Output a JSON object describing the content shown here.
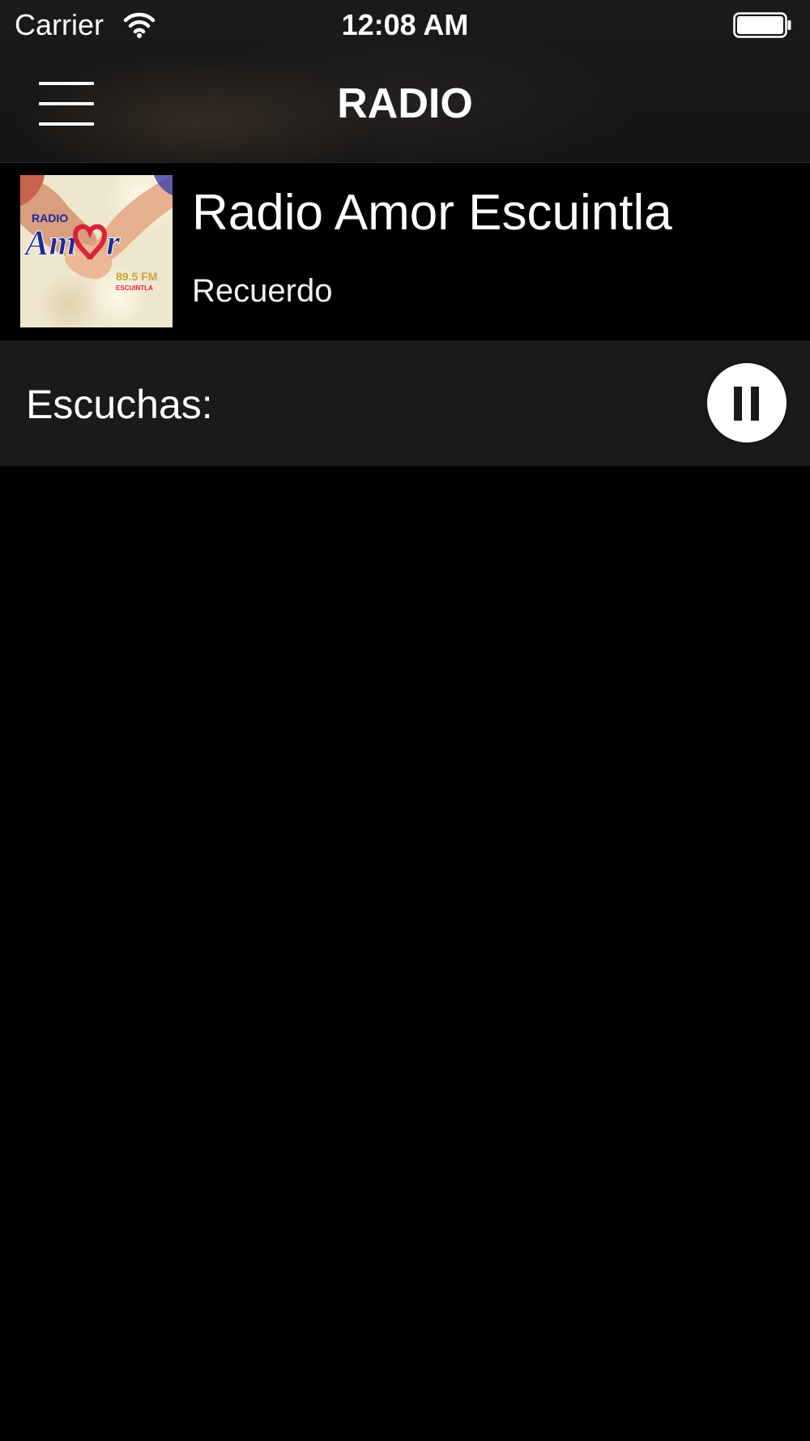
{
  "status_bar": {
    "carrier": "Carrier",
    "time": "12:08 AM",
    "icons": [
      "wifi-icon",
      "battery-icon"
    ]
  },
  "nav_bar": {
    "title": "RADIO",
    "menu_icon": "hamburger-menu-icon"
  },
  "station": {
    "name": "Radio Amor Escuintla",
    "genre": "Recuerdo",
    "logo": {
      "top_text": "RADIO",
      "brand_text": "Amor",
      "frequency": "89.5 FM",
      "city": "ESCUINTLA"
    }
  },
  "player": {
    "listeners_label": "Escuchas:",
    "control_icon": "pause-icon"
  },
  "colors": {
    "background": "#000000",
    "header": "#1a1a1a",
    "player_bar": "#1a1a1a",
    "text": "#ffffff",
    "logo_blue": "#1b2a9a",
    "logo_red": "#d8243a"
  }
}
